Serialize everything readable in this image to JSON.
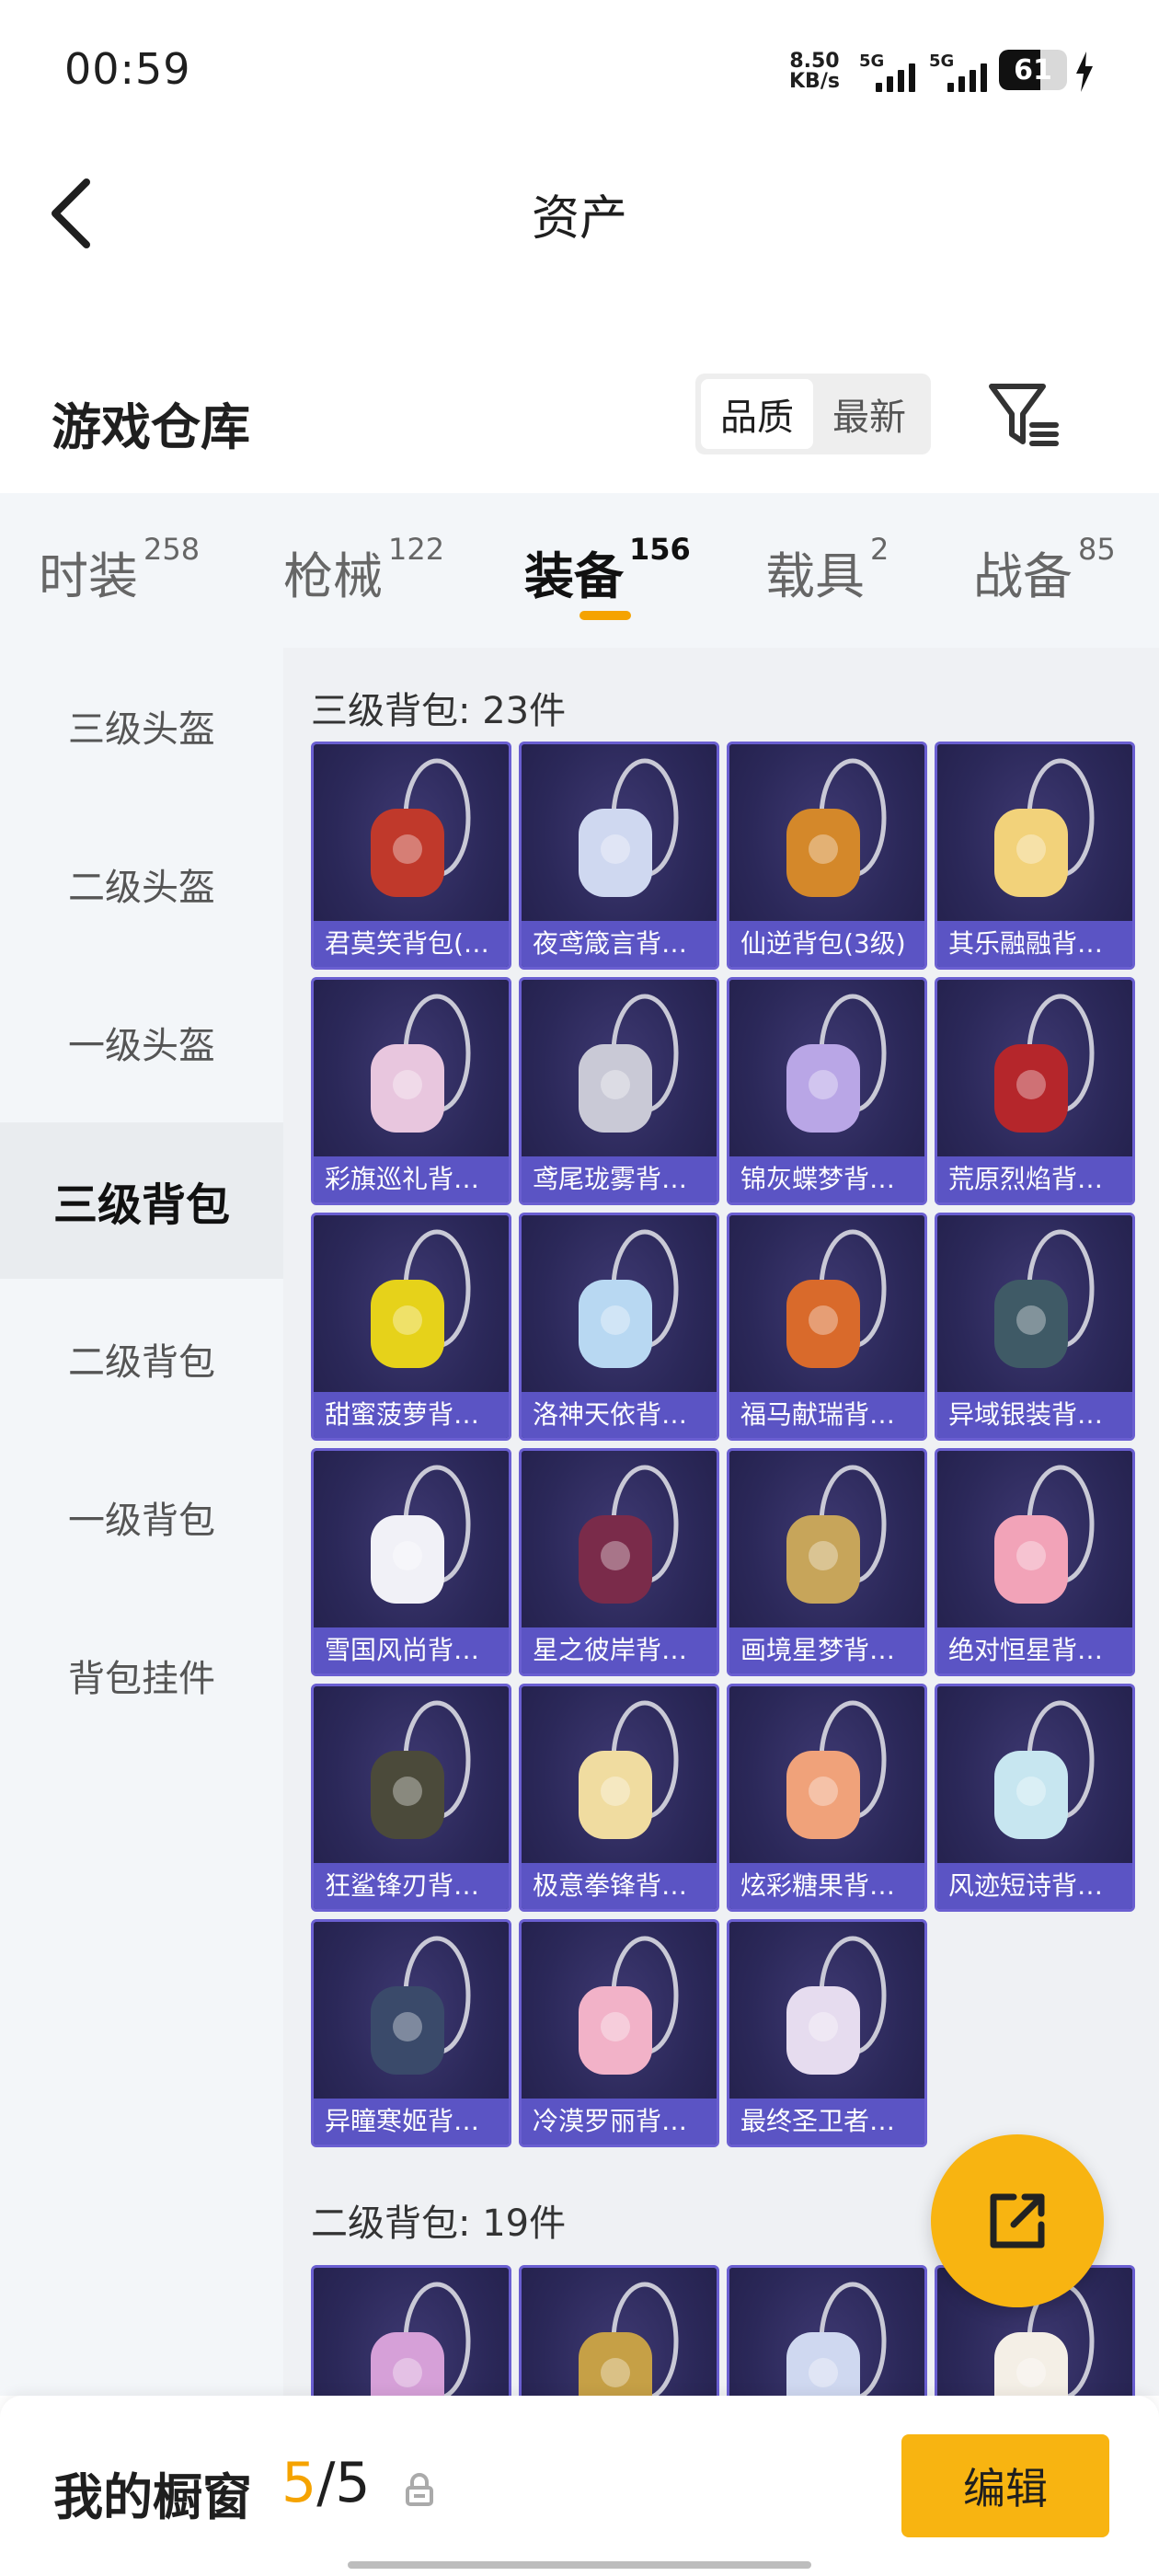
{
  "status_bar": {
    "time": "00:59",
    "net_speed_value": "8.50",
    "net_speed_unit": "KB/s",
    "sim1": "5G",
    "sim2": "5G",
    "battery_level": 61,
    "battery_text": "61"
  },
  "header": {
    "title": "资产"
  },
  "warehouse": {
    "title": "游戏仓库",
    "sort_options": [
      "品质",
      "最新"
    ],
    "sort_selected": "品质"
  },
  "tabs": [
    {
      "label": "时装",
      "count": "258"
    },
    {
      "label": "枪械",
      "count": "122"
    },
    {
      "label": "装备",
      "count": "156",
      "active": true
    },
    {
      "label": "载具",
      "count": "2"
    },
    {
      "label": "战备",
      "count": "85"
    }
  ],
  "sidebar": {
    "items": [
      "三级头盔",
      "二级头盔",
      "一级头盔",
      "三级背包",
      "二级背包",
      "一级背包",
      "背包挂件"
    ],
    "active": "三级背包"
  },
  "sections": [
    {
      "title": "三级背包: 23件",
      "items": [
        {
          "name": "君莫笑背包(…",
          "color": "#c0392b"
        },
        {
          "name": "夜鸢箴言背…",
          "color": "#cfd8f0"
        },
        {
          "name": "仙逆背包(3级)",
          "color": "#d4882a"
        },
        {
          "name": "其乐融融背…",
          "color": "#f2d27a"
        },
        {
          "name": "彩旗巡礼背…",
          "color": "#e8c6de"
        },
        {
          "name": "鸢尾珑雾背…",
          "color": "#c9c9d6"
        },
        {
          "name": "锦灰蝶梦背…",
          "color": "#b9a6e6"
        },
        {
          "name": "荒原烈焰背…",
          "color": "#b5262b"
        },
        {
          "name": "甜蜜菠萝背…",
          "color": "#e6d21a"
        },
        {
          "name": "洛神天依背…",
          "color": "#b8d8f2"
        },
        {
          "name": "福马献瑞背…",
          "color": "#d96a2b"
        },
        {
          "name": "异域银装背…",
          "color": "#3f5a66"
        },
        {
          "name": "雪国风尚背…",
          "color": "#f1f1f7"
        },
        {
          "name": "星之彼岸背…",
          "color": "#7a2b4a"
        },
        {
          "name": "画境星梦背…",
          "color": "#c7a55a"
        },
        {
          "name": "绝对恒星背…",
          "color": "#f2a3b8"
        },
        {
          "name": "狂鲨锋刃背…",
          "color": "#4b4a3a"
        },
        {
          "name": "极意拳锋背…",
          "color": "#f0dca0"
        },
        {
          "name": "炫彩糖果背…",
          "color": "#f0a27a"
        },
        {
          "name": "风迹短诗背…",
          "color": "#c7e6f0"
        },
        {
          "name": "异瞳寒姬背…",
          "color": "#3a4a6a"
        },
        {
          "name": "冷漠罗丽背…",
          "color": "#f2b2c8"
        },
        {
          "name": "最终圣卫者…",
          "color": "#e6dcef"
        }
      ]
    },
    {
      "title": "二级背包: 19件",
      "items": [
        {
          "name": "",
          "color": "#d6a0d8"
        },
        {
          "name": "",
          "color": "#c6a046"
        },
        {
          "name": "",
          "color": "#cfd8f0"
        },
        {
          "name": "",
          "color": "#f4efe6"
        }
      ]
    }
  ],
  "bottom": {
    "label": "我的橱窗",
    "current": "5",
    "separator": "/",
    "total": "5",
    "edit_label": "编辑"
  },
  "colors": {
    "accent": "#f8b411",
    "card_label": "#5b54c4",
    "card_bg": "#2b2859"
  }
}
